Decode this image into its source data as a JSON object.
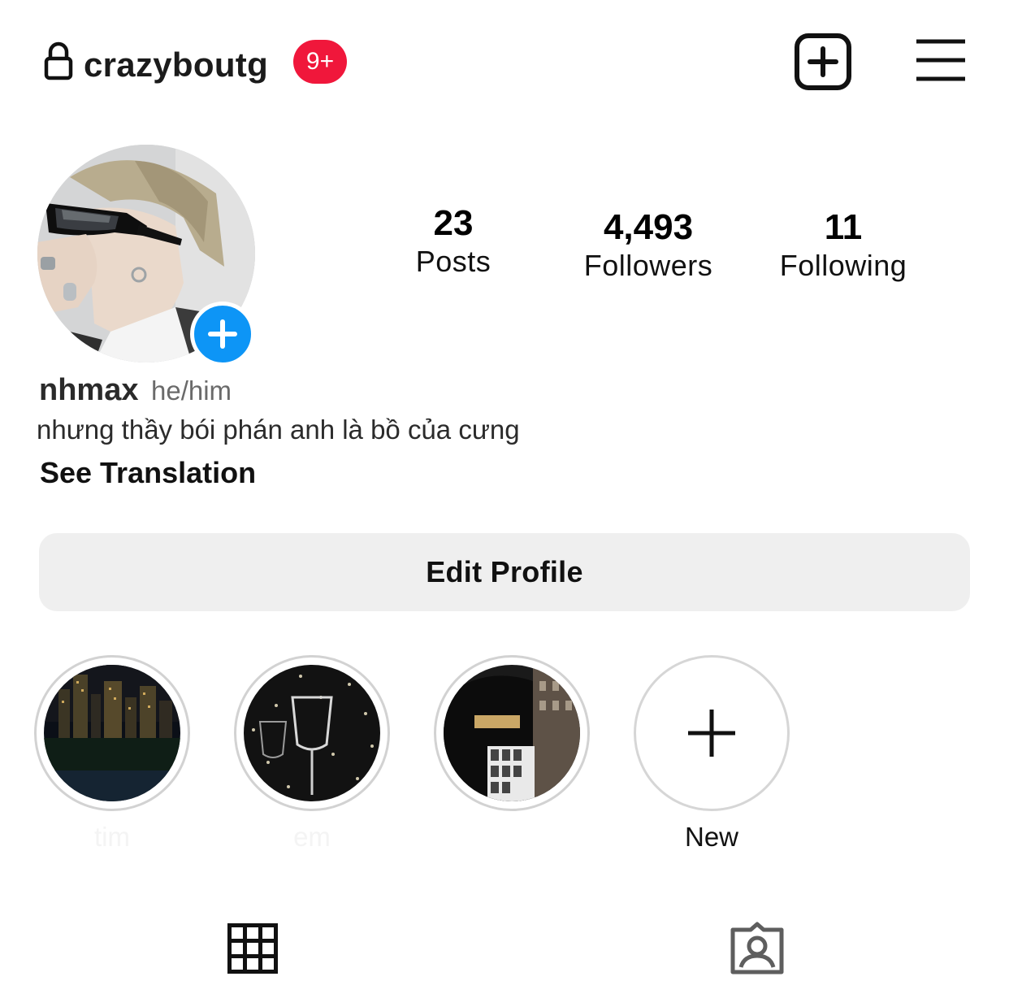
{
  "header": {
    "username": "crazyboutg",
    "notification_badge": "9+",
    "icons": {
      "lock": "lock-icon",
      "create": "plus-square-icon",
      "menu": "hamburger-menu-icon"
    }
  },
  "profile": {
    "avatar": "profile-photo",
    "add_story_icon": "plus-icon",
    "display_name": "nhmax",
    "pronouns": "he/him",
    "bio": "nhưng thầy bói phán anh là bồ của cưng",
    "see_translation": "See Translation"
  },
  "stats": {
    "posts": {
      "value": "23",
      "label": "Posts"
    },
    "followers": {
      "value": "4,493",
      "label": "Followers"
    },
    "following": {
      "value": "11",
      "label": "Following"
    }
  },
  "actions": {
    "edit_profile": "Edit Profile"
  },
  "highlights": {
    "items": [
      {
        "label": "tim",
        "thumbnail": "city-night-photo"
      },
      {
        "label": "em",
        "thumbnail": "wine-glasses-photo"
      },
      {
        "label": "",
        "thumbnail": "vogue-store-photo"
      }
    ],
    "new_label": "New"
  },
  "tabs": {
    "grid": "grid-icon",
    "tagged": "tagged-person-icon"
  },
  "colors": {
    "badge": "#f0173b",
    "add_story": "#0d95f6",
    "button_bg": "#efefef"
  }
}
